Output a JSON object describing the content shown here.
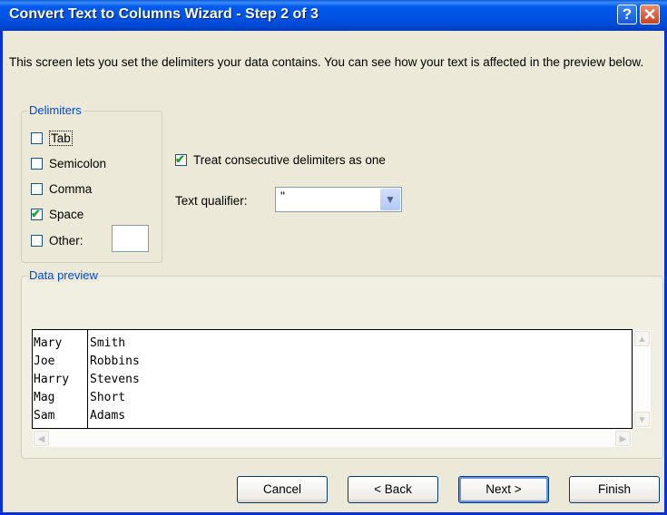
{
  "window": {
    "title": "Convert Text to Columns Wizard - Step 2 of 3",
    "help_label": "?",
    "close_label": "✕"
  },
  "description": "This screen lets you set the delimiters your data contains.  You can see how your text is affected in the preview below.",
  "delimiters": {
    "group_label": "Delimiters",
    "options": [
      {
        "label": "Tab",
        "checked": false
      },
      {
        "label": "Semicolon",
        "checked": false
      },
      {
        "label": "Comma",
        "checked": false
      },
      {
        "label": "Space",
        "checked": true
      },
      {
        "label": "Other:",
        "checked": false
      }
    ],
    "other_value": ""
  },
  "treat_consecutive": {
    "label": "Treat consecutive delimiters as one",
    "checked": true
  },
  "text_qualifier": {
    "label": "Text qualifier:",
    "value": "\""
  },
  "preview": {
    "group_label": "Data preview",
    "rows": [
      [
        "Mary",
        "Smith"
      ],
      [
        "Joe",
        "Robbins"
      ],
      [
        "Harry",
        "Stevens"
      ],
      [
        "Mag",
        "Short"
      ],
      [
        "Sam",
        "Adams"
      ]
    ]
  },
  "buttons": {
    "cancel": "Cancel",
    "back": "< Back",
    "next": "Next >",
    "finish": "Finish"
  },
  "colors": {
    "title_bar": "#0054e3",
    "dialog_bg": "#ece9d8",
    "group_label": "#0046d5",
    "check": "#21a121"
  }
}
